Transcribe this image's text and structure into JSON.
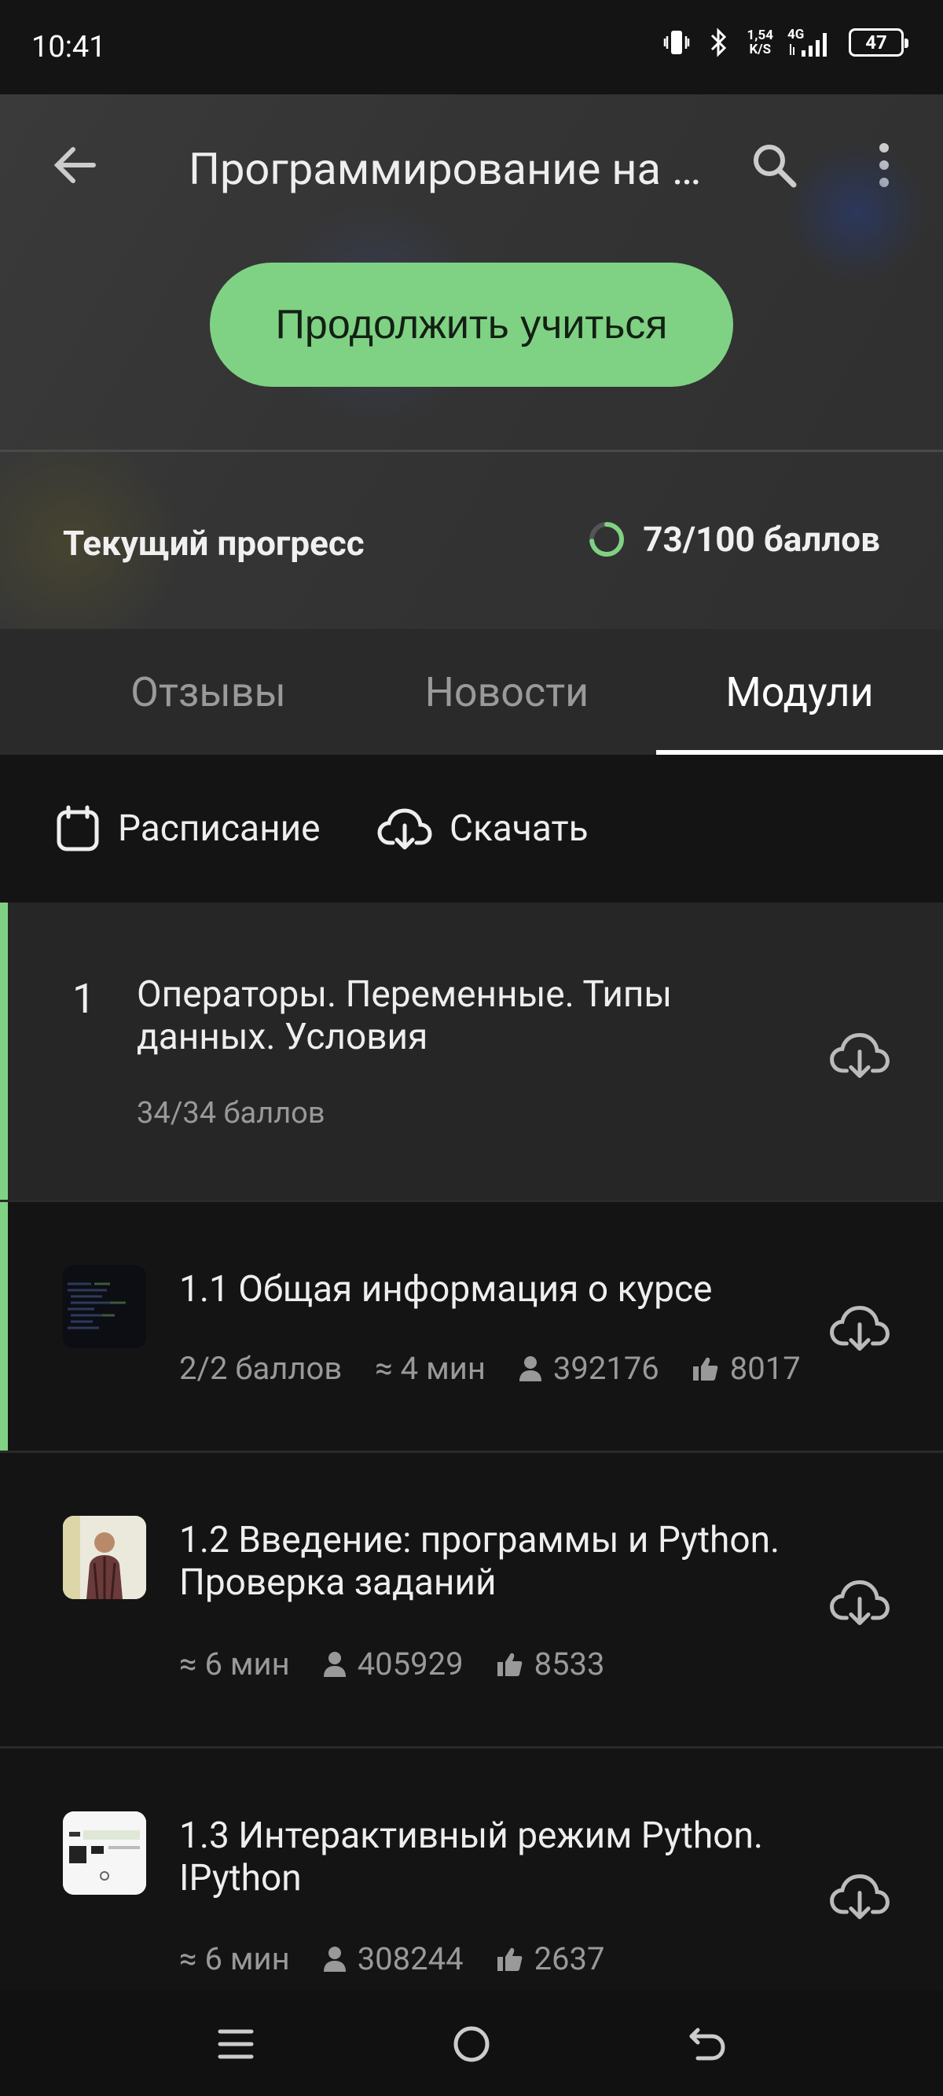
{
  "status_bar": {
    "time": "10:41",
    "net_speed_value": "1,54",
    "net_speed_unit": "K/S",
    "network_type": "4G",
    "battery": "47"
  },
  "header": {
    "title": "Программирование на Python",
    "continue_label": "Продолжить учиться",
    "progress_label": "Текущий прогресс",
    "progress_value": "73/100 баллов",
    "progress_fraction": 0.73,
    "accent_color": "#7fd283"
  },
  "tabs": [
    {
      "label": "Отзывы",
      "selected": false
    },
    {
      "label": "Новости",
      "selected": false
    },
    {
      "label": "Модули",
      "selected": true
    }
  ],
  "actions": {
    "schedule_label": "Расписание",
    "download_label": "Скачать"
  },
  "module": {
    "number": "1",
    "title": "Операторы. Переменные. Типы данных. Условия",
    "score": "34/34 баллов"
  },
  "lessons": [
    {
      "title": "1.1 Общая информация о курсе",
      "score": "2/2 баллов",
      "duration": "≈ 4 мин",
      "learners": "392176",
      "likes": "8017"
    },
    {
      "title": "1.2 Введение: программы и Python. Проверка заданий",
      "duration": "≈ 6 мин",
      "learners": "405929",
      "likes": "8533"
    },
    {
      "title": "1.3 Интерактивный режим Python. IPython",
      "duration": "≈ 6 мин",
      "learners": "308244",
      "likes": "2637"
    }
  ]
}
